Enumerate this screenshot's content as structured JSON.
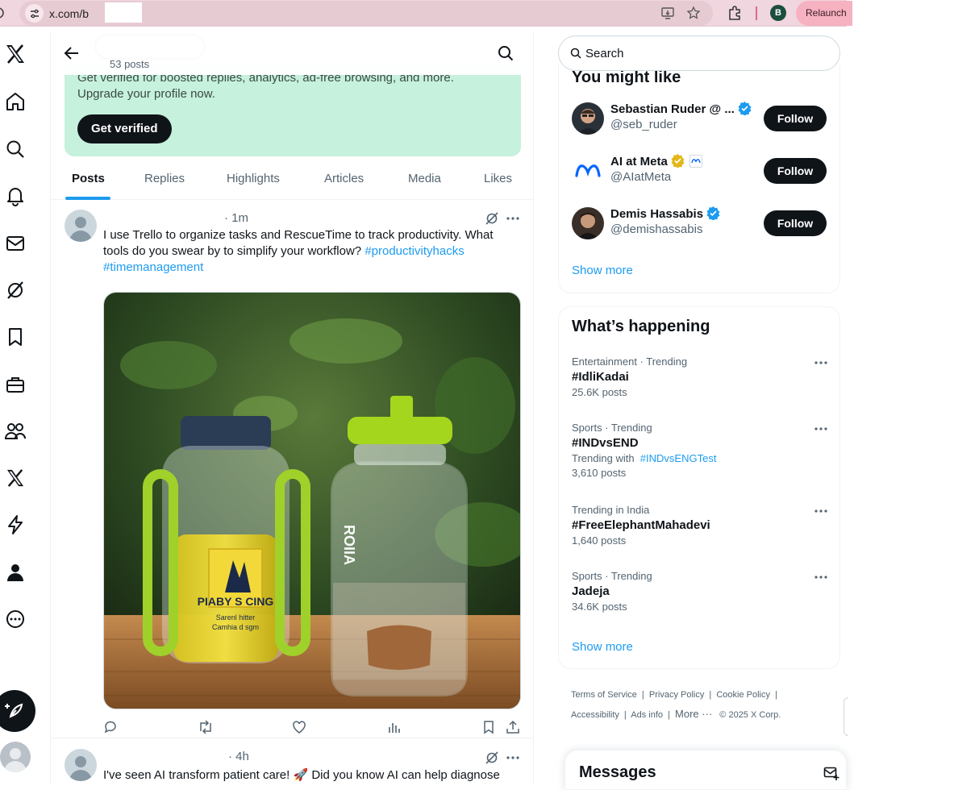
{
  "browser": {
    "url": "x.com/b",
    "profile_initial": "B",
    "relaunch_label": "Relaunch"
  },
  "header": {
    "post_count": "53 posts"
  },
  "verify": {
    "text": "Get verified for boosted replies, analytics, ad-free browsing, and more. Upgrade your profile now.",
    "button_label": "Get verified"
  },
  "tabs": [
    "Posts",
    "Replies",
    "Highlights",
    "Articles",
    "Media",
    "Likes"
  ],
  "tweets": [
    {
      "time": "· 1m",
      "text": "I use Trello to organize tasks and RescueTime to track productivity. What tools do you swear by to simplify your workflow?",
      "hashtags": [
        "#productivityhacks",
        "#timemanagement"
      ],
      "image_label_main": "PIABY S CING",
      "image_label_sub1": "Sarenl hitter",
      "image_label_sub2": "Camhia d sgm",
      "image_side_text": "ROIIA"
    },
    {
      "time": "· 4h",
      "text": "I've seen AI transform patient care! 🚀 Did you know AI can help diagnose"
    }
  ],
  "right": {
    "search_placeholder": "Search",
    "wtf_title": "You might like",
    "suggestions": [
      {
        "name": "Sebastian Ruder @ ...",
        "handle": "@seb_ruder",
        "badge": "blue",
        "follow": "Follow"
      },
      {
        "name": "AI at Meta",
        "handle": "@AIatMeta",
        "badge": "gold",
        "follow": "Follow"
      },
      {
        "name": "Demis Hassabis",
        "handle": "@demishassabis",
        "badge": "blue",
        "follow": "Follow"
      }
    ],
    "show_more": "Show more",
    "trends_title": "What’s happening",
    "trends": [
      {
        "category": "Entertainment · Trending",
        "name": "#IdliKadai",
        "count": "25.6K posts"
      },
      {
        "category": "Sports · Trending",
        "name": "#INDvsEND",
        "with_label": "Trending with",
        "with_tag": "#INDvsENGTest",
        "count": "3,610 posts"
      },
      {
        "category": "Trending in India",
        "name": "#FreeElephantMahadevi",
        "count": "1,640 posts"
      },
      {
        "category": "Sports · Trending",
        "name": "Jadeja",
        "count": "34.6K posts"
      }
    ],
    "footer": [
      "Terms of Service",
      "Privacy Policy",
      "Cookie Policy",
      "Accessibility",
      "Ads info",
      "More ···",
      "© 2025 X Corp."
    ]
  },
  "messages": {
    "title": "Messages"
  },
  "colors": {
    "accent": "#1d9bf0",
    "verify_bg": "#c6f1dd",
    "browser_bar": "#f0d6de"
  }
}
